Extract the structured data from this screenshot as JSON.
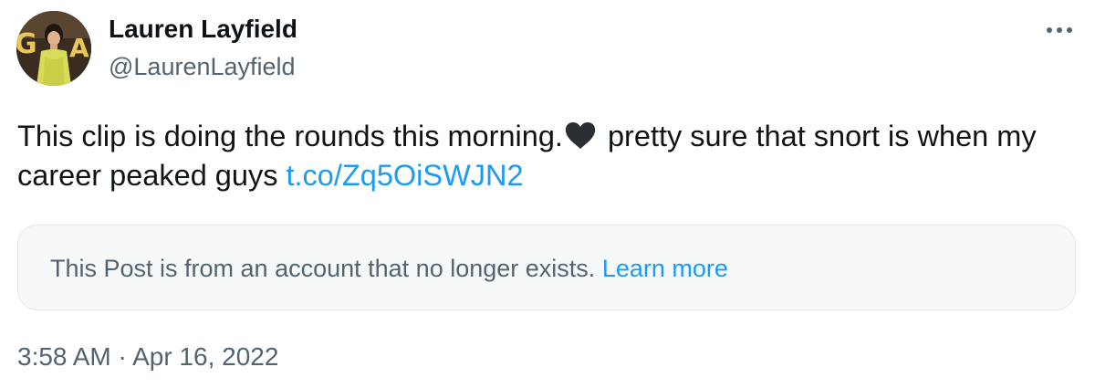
{
  "author": {
    "name": "Lauren Layfield",
    "handle": "@LaurenLayfield",
    "avatar_icon": "profile-photo"
  },
  "more_icon": "more-horizontal-icon",
  "tweet": {
    "text_before_emoji": "This clip is doing the rounds this morning.",
    "emoji": "black-heart",
    "text_after_emoji": " pretty sure that snort is when my career peaked guys ",
    "link": "t.co/Zq5OiSWJN2"
  },
  "notice": {
    "text": "This Post is from an account that no longer exists.",
    "link": "Learn more"
  },
  "timestamp": {
    "time": "3:58 AM",
    "separator": "·",
    "date": "Apr 16, 2022"
  },
  "colors": {
    "text": "#0f1419",
    "secondary": "#536471",
    "link": "#1d9bf0",
    "notice_bg": "#f7f9f9"
  }
}
